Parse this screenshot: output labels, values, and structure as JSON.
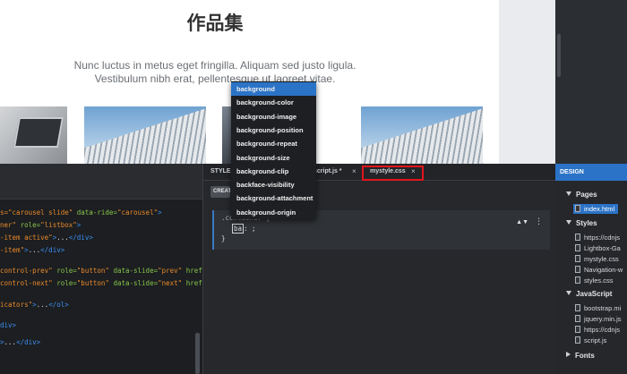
{
  "preview": {
    "title": "作品集",
    "line1": "Nunc luctus in metus eget fringilla. Aliquam sed justo ligula.",
    "line2": "Vestibulum nibh erat, pellentesque ut laoreet vitae."
  },
  "editor_tabs": {
    "styles_label": "STYLE",
    "script_tab": "script.js *",
    "mystyle_tab": "mystyle.css",
    "close_glyph": "×",
    "create_label": "CREATE"
  },
  "html_code": [
    {
      "parts": [
        [
          "s",
          "s=\"carousel slide\" "
        ],
        [
          "a",
          "data-ride="
        ],
        [
          "s",
          "\"carousel\""
        ],
        [
          "t",
          ">"
        ]
      ]
    },
    {
      "parts": [
        [
          "s",
          "ner\" "
        ],
        [
          "a",
          "role="
        ],
        [
          "s",
          "\"listbox\""
        ],
        [
          "t",
          ">"
        ]
      ]
    },
    {
      "parts": [
        [
          "s",
          "-item active\""
        ],
        [
          "t",
          ">"
        ],
        [
          "w",
          "..."
        ],
        [
          "t",
          "</div>"
        ]
      ]
    },
    {
      "parts": [
        [
          "s",
          "-item\""
        ],
        [
          "t",
          ">"
        ],
        [
          "w",
          "..."
        ],
        [
          "t",
          "</div>"
        ]
      ]
    },
    {
      "parts": [
        [
          "s",
          "control-prev\" "
        ],
        [
          "a",
          "role="
        ],
        [
          "s",
          "\"button\" "
        ],
        [
          "a",
          "data-slide="
        ],
        [
          "s",
          "\"prev\" "
        ],
        [
          "a",
          "href="
        ],
        [
          "s",
          "\"#carouse"
        ]
      ]
    },
    {
      "parts": [
        [
          "s",
          "control-next\" "
        ],
        [
          "a",
          "role="
        ],
        [
          "s",
          "\"button\" "
        ],
        [
          "a",
          "data-slide="
        ],
        [
          "s",
          "\"next\" "
        ],
        [
          "a",
          "href="
        ],
        [
          "s",
          "\"#carouse"
        ]
      ]
    },
    {
      "parts": [
        [
          "s",
          "icators\""
        ],
        [
          "t",
          ">"
        ],
        [
          "w",
          "..."
        ],
        [
          "t",
          "</ol>"
        ]
      ]
    },
    {
      "parts": [
        [
          "t",
          "div>"
        ]
      ]
    },
    {
      "parts": [
        [
          "t",
          ">"
        ],
        [
          "w",
          "..."
        ],
        [
          "t",
          "</div>"
        ]
      ]
    }
  ],
  "css_rule": {
    "selector": ".container",
    "open_brace": "{",
    "property": "ba",
    "after": ": ;",
    "close_brace": "}",
    "caret": "▲▼",
    "menu": "⋮"
  },
  "autocomplete": {
    "items": [
      "background",
      "background-color",
      "background-image",
      "background-position",
      "background-repeat",
      "background-size",
      "background-clip",
      "backface-visibility",
      "background-attachment",
      "background-origin"
    ],
    "selected_index": 0
  },
  "design": {
    "header": "DESIGN",
    "pages_label": "Pages",
    "pages": [
      "index.html"
    ],
    "styles_label": "Styles",
    "styles": [
      "https://cdnjs",
      "Lightbox-Ga",
      "mystyle.css",
      "Navigation-w",
      "styles.css"
    ],
    "js_label": "JavaScript",
    "scripts": [
      "bootstrap.mi",
      "jquery.min.js",
      "https://cdnjs",
      "script.js"
    ],
    "fonts_label": "Fonts"
  }
}
